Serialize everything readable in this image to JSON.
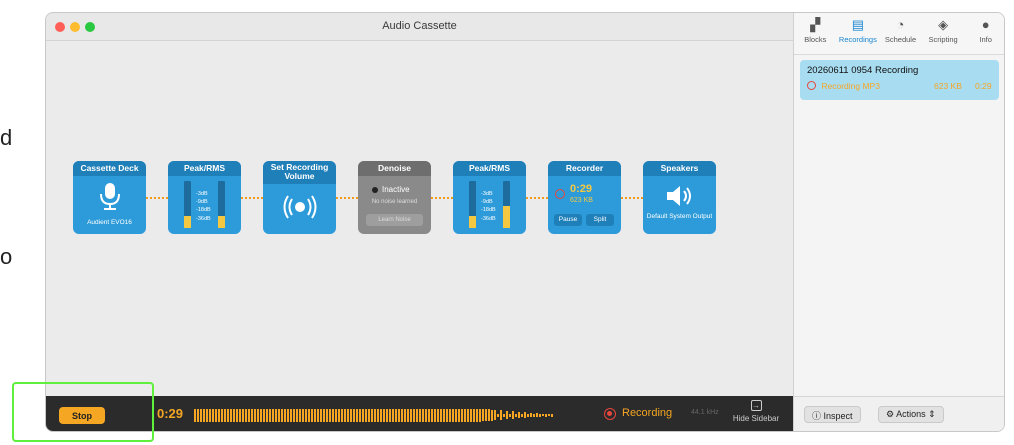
{
  "background": {
    "fragments": [
      "d",
      "o"
    ]
  },
  "window": {
    "title": "Audio Cassette"
  },
  "pipeline": {
    "cassette_deck": {
      "title": "Cassette Deck",
      "device": "Audient EVO16"
    },
    "peak_rms_1": {
      "title": "Peak/RMS",
      "levels": [
        "-3dB",
        "-9dB",
        "-18dB",
        "-36dB"
      ]
    },
    "set_volume": {
      "title": "Set Recording Volume"
    },
    "denoise": {
      "title": "Denoise",
      "status": "Inactive",
      "note": "No noise learned",
      "button": "Learn Noise"
    },
    "peak_rms_2": {
      "title": "Peak/RMS",
      "levels": [
        "-3dB",
        "-9dB",
        "-18dB",
        "-36dB"
      ]
    },
    "recorder": {
      "title": "Recorder",
      "time": "0:29",
      "size": "623 KB",
      "pause": "Pause",
      "split": "Split"
    },
    "speakers": {
      "title": "Speakers",
      "output": "Default System Output"
    }
  },
  "bottombar": {
    "stop": "Stop",
    "time": "0:29",
    "status": "Recording",
    "sample_rate": "44.1 kHz",
    "hide_sidebar": "Hide Sidebar"
  },
  "sidebar": {
    "tabs": [
      {
        "label": "Blocks",
        "icon": "blocks-icon"
      },
      {
        "label": "Recordings",
        "icon": "recordings-icon"
      },
      {
        "label": "Schedule",
        "icon": "clock-icon"
      },
      {
        "label": "Scripting",
        "icon": "diamond-icon"
      },
      {
        "label": "Info",
        "icon": "info-icon"
      }
    ],
    "recording": {
      "name": "20260611 0954 Recording",
      "format": "Recording MP3",
      "size": "623 KB",
      "duration": "0:29"
    },
    "inspect": "Inspect",
    "actions": "Actions"
  },
  "colors": {
    "accent_orange": "#f5a623",
    "block_blue": "#2d9bd9",
    "selection": "#a8dcf0",
    "record_red": "#e8453c"
  }
}
